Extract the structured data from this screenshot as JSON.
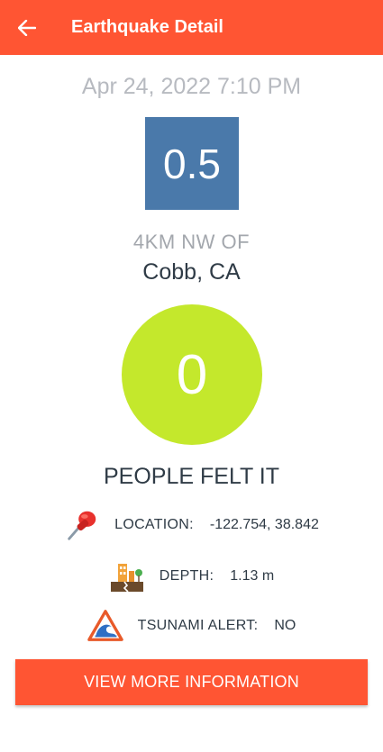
{
  "appbar": {
    "title": "Earthquake Detail",
    "back_icon": "arrow-left-icon"
  },
  "quake": {
    "date": "Apr 24, 2022 7:10 PM",
    "magnitude": "0.5",
    "offset": "4KM NW OF",
    "place": "Cobb, CA",
    "felt_count": "0",
    "felt_label": "PEOPLE FELT IT"
  },
  "details": {
    "location_label": "LOCATION:",
    "location_value": "-122.754, 38.842",
    "location_icon": "pushpin-icon",
    "depth_label": "DEPTH:",
    "depth_value": "1.13 m",
    "depth_icon": "building-crack-icon",
    "tsunami_label": "TSUNAMI ALERT:",
    "tsunami_value": "NO",
    "tsunami_icon": "tsunami-warning-icon"
  },
  "actions": {
    "more_label": "VIEW MORE INFORMATION"
  },
  "colors": {
    "accent": "#ff5533",
    "magnitude_box": "#4a79aa",
    "felt_circle": "#c4e82c",
    "date_text": "#b7bac0",
    "primary_text": "#2f3b46"
  }
}
